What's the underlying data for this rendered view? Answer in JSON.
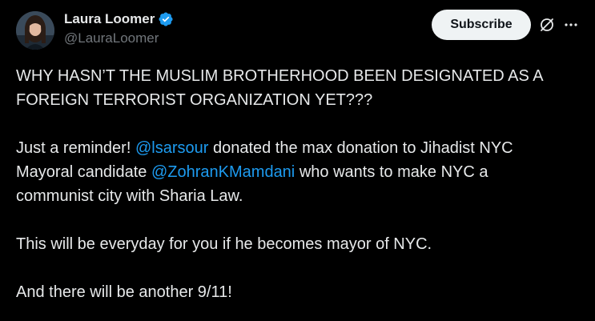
{
  "author": {
    "display_name": "Laura Loomer",
    "handle": "@LauraLoomer",
    "verified": true,
    "verified_icon": "verified-badge-icon",
    "verified_color": "#1d9bf0"
  },
  "actions": {
    "subscribe_label": "Subscribe",
    "grok_icon": "grok-icon",
    "more_icon": "more-options-icon"
  },
  "post": {
    "line1": "WHY HASN’T THE MUSLIM BROTHERHOOD BEEN DESIGNATED AS A",
    "line2": "FOREIGN TERRORIST ORGANIZATION YET???",
    "p2_text1": "Just a reminder! ",
    "p2_mention1": "@lsarsour",
    "p2_text2": " donated the max donation to Jihadist NYC",
    "p2_text3": "Mayoral candidate ",
    "p2_mention2": "@ZohranKMamdani",
    "p2_text4": " who wants to make NYC a",
    "p2_text5": "communist city with Sharia Law.",
    "p3": "This will be everyday for you if he becomes mayor of NYC.",
    "p4": "And there will be another 9/11!"
  },
  "colors": {
    "background": "#000000",
    "text": "#e7e9ea",
    "secondary": "#71767b",
    "link": "#1d9bf0",
    "button_bg": "#eff3f4"
  }
}
